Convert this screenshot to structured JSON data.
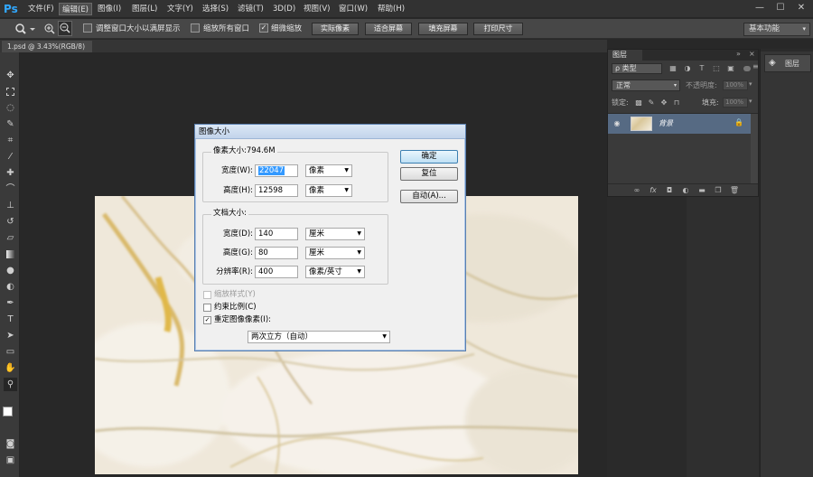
{
  "app": {
    "logo": "Ps"
  },
  "menubar": {
    "items": [
      "文件(F)",
      "编辑(E)",
      "图像(I)",
      "图层(L)",
      "文字(Y)",
      "选择(S)",
      "滤镜(T)",
      "3D(D)",
      "视图(V)",
      "窗口(W)",
      "帮助(H)"
    ],
    "window_controls": [
      "—",
      "☐",
      "✕"
    ]
  },
  "options_bar": {
    "zoom_tool_icon": "zoom-icon",
    "zoom_in_icon": "zoom-in-icon",
    "zoom_out_icon": "zoom-out-icon",
    "resize_windows_label": "调整窗口大小以满屏显示",
    "zoom_all_label": "缩放所有窗口",
    "scrubby_label": "细微缩放",
    "actual_pixels": "实际像素",
    "fit_screen": "适合屏幕",
    "fill_screen": "填充屏幕",
    "print_size": "打印尺寸",
    "workspace": "基本功能"
  },
  "document_tab": {
    "title": "1.psd @ 3.43%(RGB/8)"
  },
  "layers_panel": {
    "tab": "图层",
    "kind_label": "ρ 类型",
    "blend_mode": "正常",
    "opacity_label": "不透明度:",
    "opacity_value": "100%",
    "lock_label": "锁定:",
    "fill_label": "填充:",
    "fill_value": "100%",
    "layer_name": "背景"
  },
  "dock": {
    "layers_button": "图层"
  },
  "dialog": {
    "title": "图像大小",
    "pixel_dims_label": "像素大小:794.6M",
    "width_label": "宽度(W):",
    "width_value": "22047",
    "width_unit": "像素",
    "height_label": "高度(H):",
    "height_value": "12598",
    "height_unit": "像素",
    "doc_size_label": "文档大小:",
    "doc_width_label": "宽度(D):",
    "doc_width_value": "140",
    "doc_width_unit": "厘米",
    "doc_height_label": "高度(G):",
    "doc_height_value": "80",
    "doc_height_unit": "厘米",
    "resolution_label": "分辨率(R):",
    "resolution_value": "400",
    "resolution_unit": "像素/英寸",
    "scale_styles": "缩放样式(Y)",
    "constrain": "约束比例(C)",
    "resample": "重定图像像素(I):",
    "resample_method": "两次立方（自动）",
    "ok": "确定",
    "reset": "复位",
    "auto": "自动(A)...",
    "checked_mark": "✓"
  }
}
